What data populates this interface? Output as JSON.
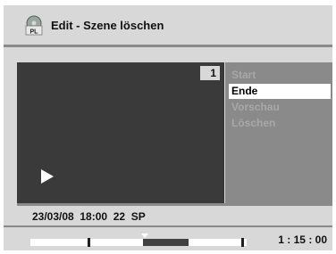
{
  "header": {
    "icon_text": "PL",
    "title": "Edit - Szene löschen"
  },
  "preview": {
    "scene_number": "1"
  },
  "menu": {
    "items": [
      {
        "label": "Start",
        "selected": false
      },
      {
        "label": "Ende",
        "selected": true
      },
      {
        "label": "Vorschau",
        "selected": false
      },
      {
        "label": "Löschen",
        "selected": false
      }
    ]
  },
  "info": {
    "text": "23/03/08  18:00  22  SP"
  },
  "progress": {
    "time": "1 : 15 : 00",
    "deleted_range": [
      0.52,
      0.73
    ],
    "playhead": 0.53
  },
  "colors": {
    "panel": "#d8d8d8",
    "video": "#3a3a3a",
    "menu_bg": "#8a8a8a",
    "selected_bg": "#ffffff",
    "disabled_text": "#a8a8a8"
  }
}
